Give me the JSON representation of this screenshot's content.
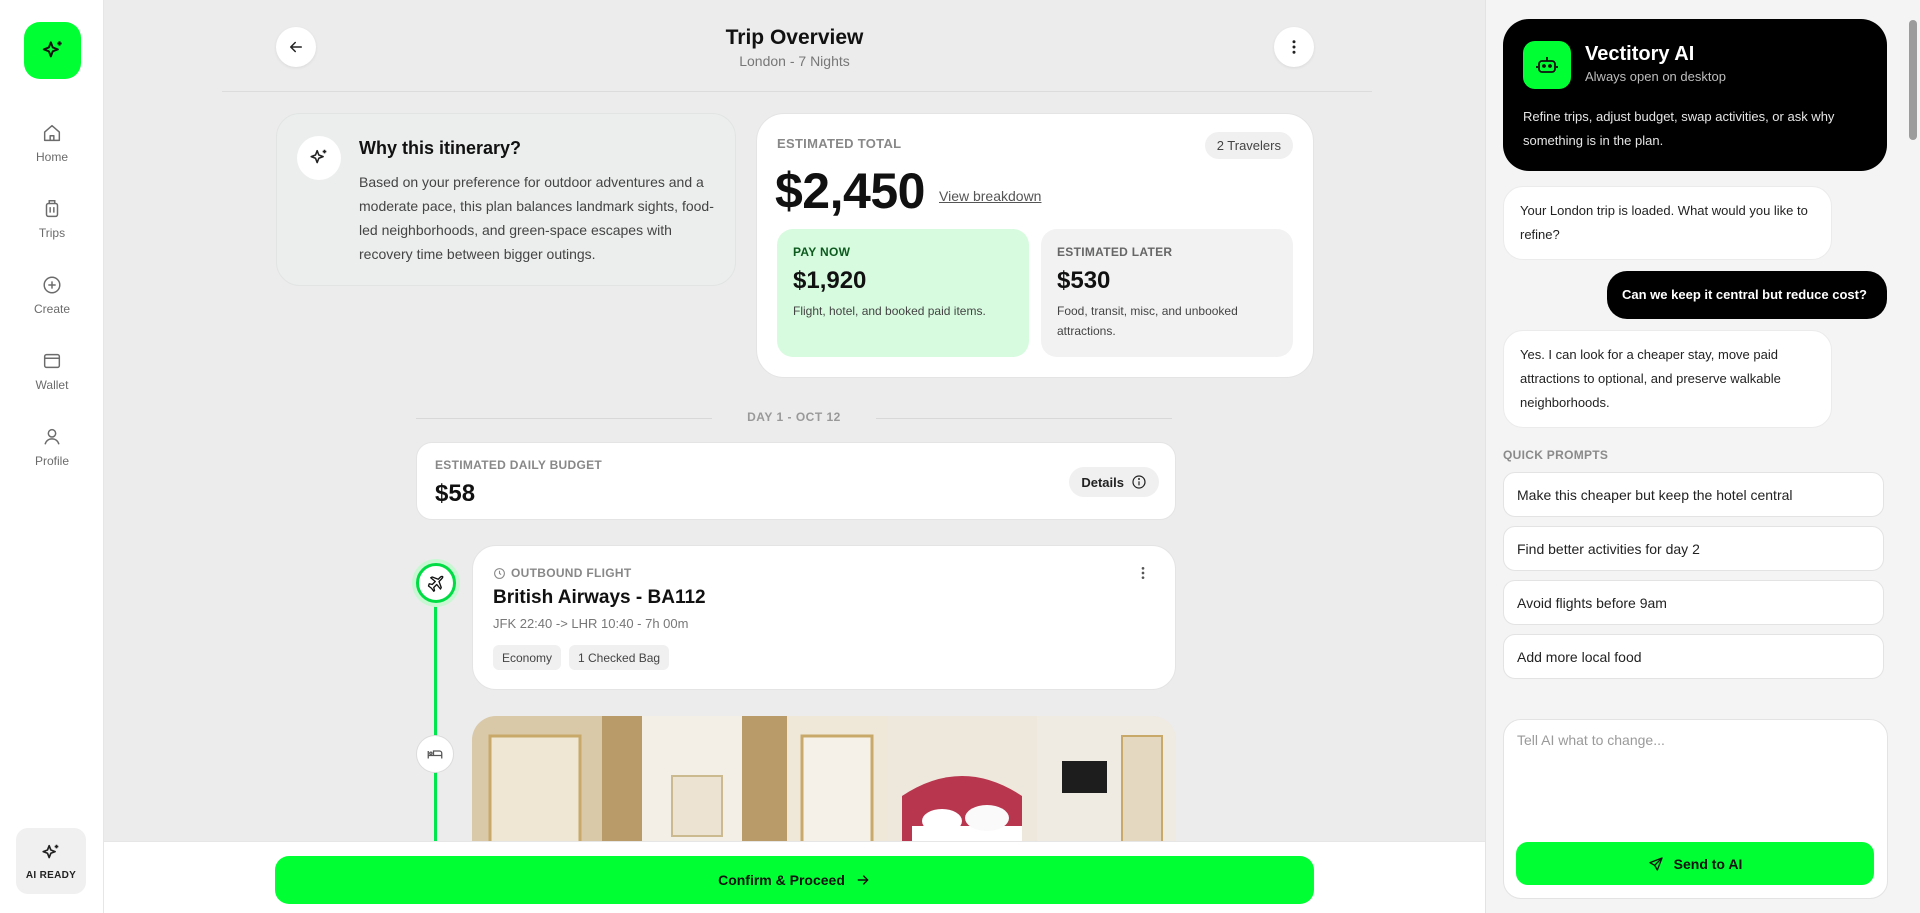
{
  "colors": {
    "accent": "#00ff33",
    "dark": "#000000",
    "background": "#ececec"
  },
  "nav": {
    "items": [
      {
        "label": "Home",
        "icon": "home-icon"
      },
      {
        "label": "Trips",
        "icon": "luggage-icon"
      },
      {
        "label": "Create",
        "icon": "plus-circle-icon"
      },
      {
        "label": "Wallet",
        "icon": "wallet-icon"
      },
      {
        "label": "Profile",
        "icon": "user-icon"
      }
    ],
    "ai_status": "AI READY"
  },
  "header": {
    "title": "Trip Overview",
    "subtitle": "London - 7 Nights"
  },
  "why": {
    "title": "Why this itinerary?",
    "body": "Based on your preference for outdoor adventures and a moderate pace, this plan balances landmark sights, food-led neighborhoods, and green-space escapes with recovery time between bigger outings."
  },
  "total": {
    "label": "ESTIMATED TOTAL",
    "travelers": "2 Travelers",
    "amount": "$2,450",
    "breakdown_link": "View breakdown",
    "pay_now": {
      "label": "PAY NOW",
      "amount": "$1,920",
      "desc": "Flight, hotel, and booked paid items."
    },
    "later": {
      "label": "ESTIMATED LATER",
      "amount": "$530",
      "desc": "Food, transit, misc, and unbooked attractions."
    }
  },
  "day": {
    "label": "DAY 1 - OCT 12",
    "budget_label": "ESTIMATED DAILY BUDGET",
    "budget_amount": "$58",
    "details_label": "Details"
  },
  "flight": {
    "kind": "OUTBOUND FLIGHT",
    "name": "British Airways - BA112",
    "route": "JFK 22:40 -> LHR 10:40 - 7h 00m",
    "tags": [
      "Economy",
      "1 Checked Bag"
    ]
  },
  "footer": {
    "confirm_label": "Confirm & Proceed"
  },
  "ai": {
    "name": "Vectitory AI",
    "status": "Always open on desktop",
    "desc": "Refine trips, adjust budget, swap activities, or ask why something is in the plan.",
    "messages": [
      {
        "from": "ai",
        "text": "Your London trip is loaded. What would you like to refine?"
      },
      {
        "from": "user",
        "text": "Can we keep it central but reduce cost?"
      },
      {
        "from": "ai",
        "text": "Yes. I can look for a cheaper stay, move paid attractions to optional, and preserve walkable neighborhoods."
      }
    ],
    "quick_label": "QUICK PROMPTS",
    "quick_prompts": [
      "Make this cheaper but keep the hotel central",
      "Find better activities for day 2",
      "Avoid flights before 9am",
      "Add more local food"
    ],
    "input_placeholder": "Tell AI what to change...",
    "send_label": "Send to AI"
  }
}
